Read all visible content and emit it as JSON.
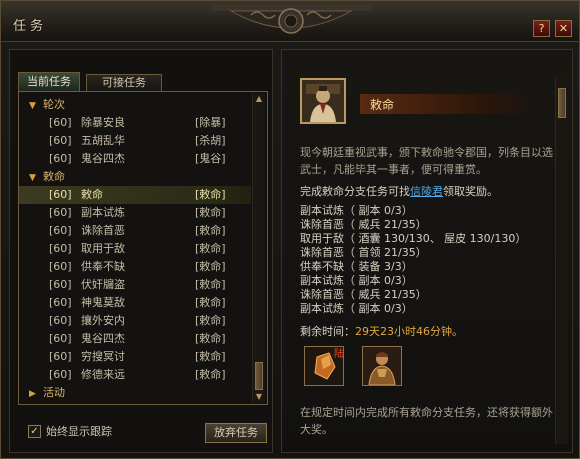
{
  "window": {
    "title": "任务",
    "help_label": "?",
    "close_label": "✕"
  },
  "tabs": {
    "current": "当前任务",
    "available": "可接任务"
  },
  "categories": [
    {
      "name": "轮次",
      "quests": [
        {
          "level": "[60]",
          "name": "除暴安良",
          "tag": "[除暴]"
        },
        {
          "level": "[60]",
          "name": "五胡乱华",
          "tag": "[杀胡]"
        },
        {
          "level": "[60]",
          "name": "鬼谷四杰",
          "tag": "[鬼谷]"
        }
      ]
    },
    {
      "name": "敕命",
      "quests": [
        {
          "level": "[60]",
          "name": "敕命",
          "tag": "[敕命]",
          "selected": true
        },
        {
          "level": "[60]",
          "name": "副本试炼",
          "tag": "[敕命]"
        },
        {
          "level": "[60]",
          "name": "诛除首恶",
          "tag": "[敕命]"
        },
        {
          "level": "[60]",
          "name": "取用于敌",
          "tag": "[敕命]"
        },
        {
          "level": "[60]",
          "name": "供奉不缺",
          "tag": "[敕命]"
        },
        {
          "level": "[60]",
          "name": "伏奸牖盗",
          "tag": "[敕命]"
        },
        {
          "level": "[60]",
          "name": "神鬼莫敌",
          "tag": "[敕命]"
        },
        {
          "level": "[60]",
          "name": "攘外安内",
          "tag": "[敕命]"
        },
        {
          "level": "[60]",
          "name": "鬼谷四杰",
          "tag": "[敕命]"
        },
        {
          "level": "[60]",
          "name": "穷搜冥讨",
          "tag": "[敕命]"
        },
        {
          "level": "[60]",
          "name": "修德来远",
          "tag": "[敕命]"
        }
      ]
    },
    {
      "name": "活动",
      "quests": []
    }
  ],
  "footer": {
    "track_label": "始终显示跟踪",
    "track_checked": "✓",
    "abandon_label": "放弃任务"
  },
  "detail": {
    "title": "敕命",
    "description": "现今朝廷重视武事，颁下敕命驰令郡国，列条目以选武士，凡能毕其一事者，便可得重赏。",
    "branch_prefix": "完成敕命分支任务可找",
    "npc_link": "信陵君",
    "branch_suffix": "领取奖励。",
    "objectives": [
      "副本试炼（ 副本 0/3）",
      "诛除首恶（ 威兵 21/35）",
      "取用于敌（ 酒囊 130/130、 屋皮 130/130）",
      "诛除首恶（ 首领 21/35）",
      "供奉不缺（ 装备 3/3）",
      "副本试炼（ 副本 0/3）",
      "诛除首恶（ 威兵 21/35）",
      "副本试炼（ 副本 0/3）"
    ],
    "remain_label": "剩余时间：",
    "remain_value": "29天23小时46分钟。",
    "reward_tag": "陆",
    "footer_text": "在规定时间内完成所有敕命分支任务，还将获得额外大奖。"
  }
}
